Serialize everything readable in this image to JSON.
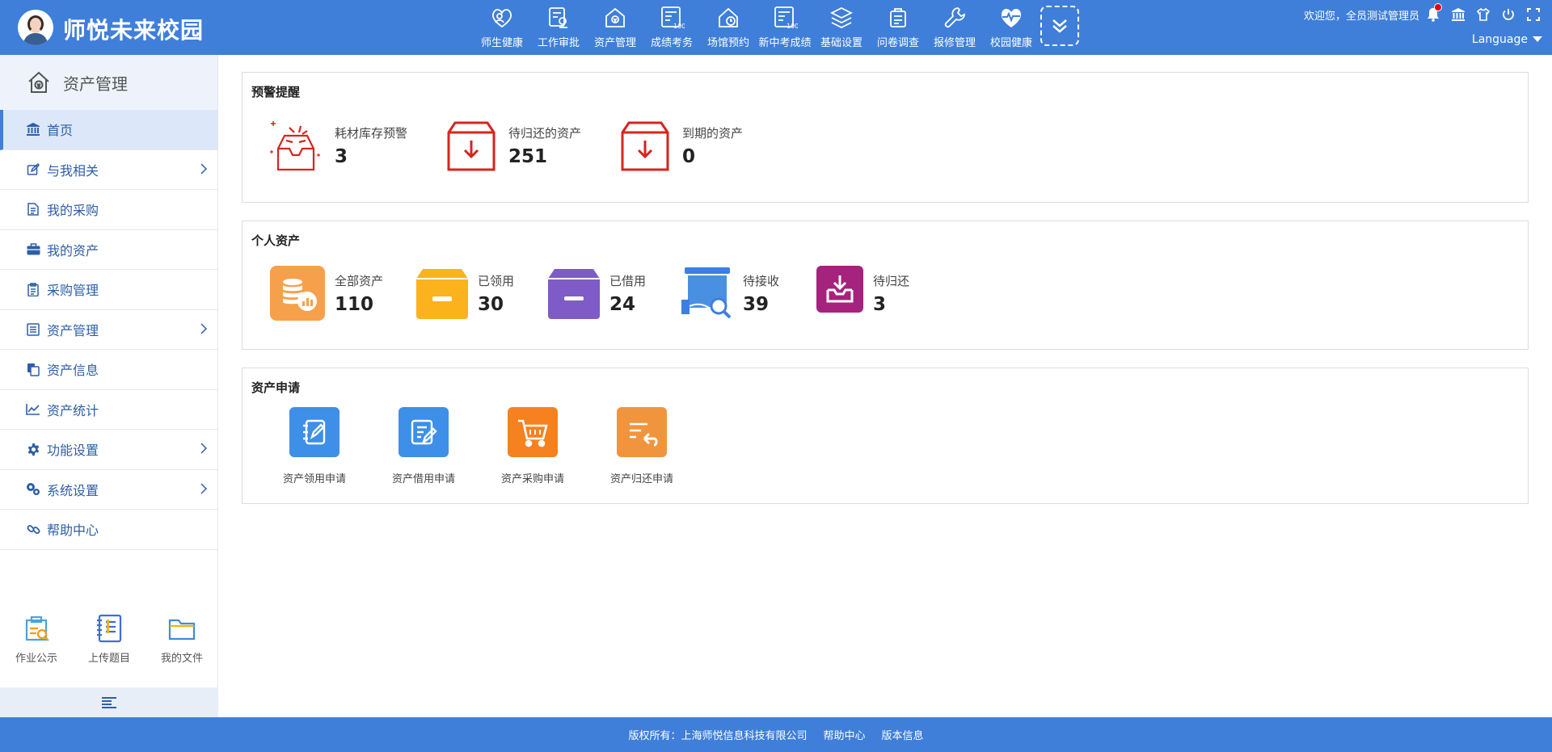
{
  "header": {
    "site_name": "师悦未来校园",
    "nav": [
      {
        "label": "师生健康",
        "icon": "health-heart-icon"
      },
      {
        "label": "工作审批",
        "icon": "approval-icon"
      },
      {
        "label": "资产管理",
        "icon": "asset-home-icon"
      },
      {
        "label": "成绩考务",
        "icon": "score-icon"
      },
      {
        "label": "场馆预约",
        "icon": "venue-icon"
      },
      {
        "label": "新中考成绩",
        "icon": "exam-score-icon"
      },
      {
        "label": "基础设置",
        "icon": "layers-icon"
      },
      {
        "label": "问卷调查",
        "icon": "survey-icon"
      },
      {
        "label": "报修管理",
        "icon": "wrench-icon"
      },
      {
        "label": "校园健康",
        "icon": "heartbeat-icon"
      }
    ],
    "welcome": "欢迎您，全员测试管理员",
    "language": "Language"
  },
  "sidebar": {
    "title": "资产管理",
    "items": [
      {
        "label": "首页",
        "icon": "bank-icon",
        "has_children": false,
        "active": true
      },
      {
        "label": "与我相关",
        "icon": "edit-icon",
        "has_children": true
      },
      {
        "label": "我的采购",
        "icon": "document-icon",
        "has_children": false
      },
      {
        "label": "我的资产",
        "icon": "briefcase-icon",
        "has_children": false
      },
      {
        "label": "采购管理",
        "icon": "clipboard-icon",
        "has_children": false
      },
      {
        "label": "资产管理",
        "icon": "list-icon",
        "has_children": true
      },
      {
        "label": "资产信息",
        "icon": "copy-icon",
        "has_children": false
      },
      {
        "label": "资产统计",
        "icon": "line-chart-icon",
        "has_children": false
      },
      {
        "label": "功能设置",
        "icon": "gear-icon",
        "has_children": true
      },
      {
        "label": "系统设置",
        "icon": "gears-icon",
        "has_children": true
      },
      {
        "label": "帮助中心",
        "icon": "link-icon",
        "has_children": false
      }
    ],
    "quick": [
      {
        "label": "作业公示",
        "icon": "homework-icon"
      },
      {
        "label": "上传题目",
        "icon": "upload-question-icon"
      },
      {
        "label": "我的文件",
        "icon": "folder-icon"
      }
    ]
  },
  "warning": {
    "title": "预警提醒",
    "stats": [
      {
        "label": "耗材库存预警",
        "value": "3",
        "icon": "inventory-tray-icon"
      },
      {
        "label": "待归还的资产",
        "value": "251",
        "icon": "return-box-icon"
      },
      {
        "label": "到期的资产",
        "value": "0",
        "icon": "expired-box-icon"
      }
    ]
  },
  "personal": {
    "title": "个人资产",
    "stats": [
      {
        "label": "全部资产",
        "value": "110",
        "icon": "all-assets-icon",
        "color": "#f7a04b"
      },
      {
        "label": "已领用",
        "value": "30",
        "icon": "received-box-icon",
        "color": "#fbb21d"
      },
      {
        "label": "已借用",
        "value": "24",
        "icon": "borrowed-box-icon",
        "color": "#7e5bc6"
      },
      {
        "label": "待接收",
        "value": "39",
        "icon": "pending-receive-icon",
        "color": "#4a90e2"
      },
      {
        "label": "待归还",
        "value": "3",
        "icon": "pending-return-icon",
        "color": "#a5237d"
      }
    ]
  },
  "apply": {
    "title": "资产申请",
    "items": [
      {
        "label": "资产领用申请",
        "icon": "receive-apply-icon",
        "color": "#3d8fe8"
      },
      {
        "label": "资产借用申请",
        "icon": "borrow-apply-icon",
        "color": "#3d8fe8"
      },
      {
        "label": "资产采购申请",
        "icon": "cart-icon",
        "color": "#f5821f"
      },
      {
        "label": "资产归还申请",
        "icon": "return-apply-icon",
        "color": "#f0953d"
      }
    ]
  },
  "footer": {
    "copyright": "版权所有：上海师悦信息科技有限公司",
    "help": "帮助中心",
    "version": "版本信息"
  }
}
